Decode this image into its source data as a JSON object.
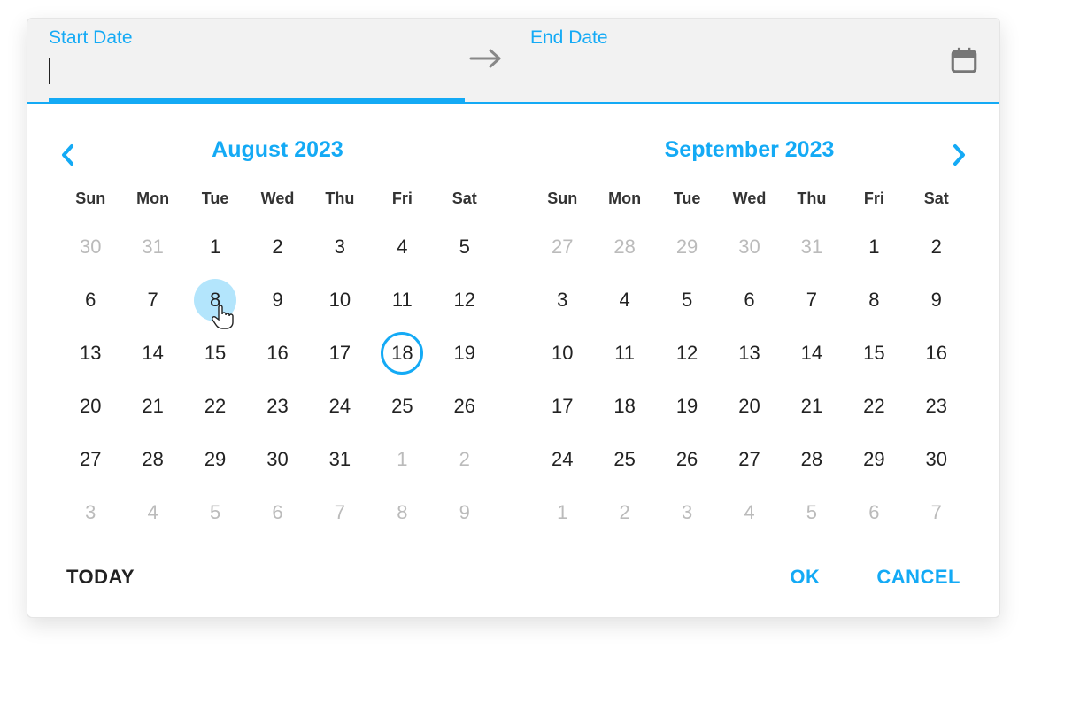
{
  "header": {
    "start_label": "Start Date",
    "end_label": "End Date"
  },
  "months": [
    {
      "title": "August 2023",
      "weekdays": [
        "Sun",
        "Mon",
        "Tue",
        "Wed",
        "Thu",
        "Fri",
        "Sat"
      ],
      "weeks": [
        [
          {
            "d": "30",
            "other": true
          },
          {
            "d": "31",
            "other": true
          },
          {
            "d": "1"
          },
          {
            "d": "2"
          },
          {
            "d": "3"
          },
          {
            "d": "4"
          },
          {
            "d": "5"
          }
        ],
        [
          {
            "d": "6"
          },
          {
            "d": "7"
          },
          {
            "d": "8",
            "hovered": true
          },
          {
            "d": "9"
          },
          {
            "d": "10"
          },
          {
            "d": "11"
          },
          {
            "d": "12"
          }
        ],
        [
          {
            "d": "13"
          },
          {
            "d": "14"
          },
          {
            "d": "15"
          },
          {
            "d": "16"
          },
          {
            "d": "17"
          },
          {
            "d": "18",
            "today": true
          },
          {
            "d": "19"
          }
        ],
        [
          {
            "d": "20"
          },
          {
            "d": "21"
          },
          {
            "d": "22"
          },
          {
            "d": "23"
          },
          {
            "d": "24"
          },
          {
            "d": "25"
          },
          {
            "d": "26"
          }
        ],
        [
          {
            "d": "27"
          },
          {
            "d": "28"
          },
          {
            "d": "29"
          },
          {
            "d": "30"
          },
          {
            "d": "31"
          },
          {
            "d": "1",
            "other": true
          },
          {
            "d": "2",
            "other": true
          }
        ],
        [
          {
            "d": "3",
            "other": true
          },
          {
            "d": "4",
            "other": true
          },
          {
            "d": "5",
            "other": true
          },
          {
            "d": "6",
            "other": true
          },
          {
            "d": "7",
            "other": true
          },
          {
            "d": "8",
            "other": true
          },
          {
            "d": "9",
            "other": true
          }
        ]
      ]
    },
    {
      "title": "September 2023",
      "weekdays": [
        "Sun",
        "Mon",
        "Tue",
        "Wed",
        "Thu",
        "Fri",
        "Sat"
      ],
      "weeks": [
        [
          {
            "d": "27",
            "other": true
          },
          {
            "d": "28",
            "other": true
          },
          {
            "d": "29",
            "other": true
          },
          {
            "d": "30",
            "other": true
          },
          {
            "d": "31",
            "other": true
          },
          {
            "d": "1"
          },
          {
            "d": "2"
          }
        ],
        [
          {
            "d": "3"
          },
          {
            "d": "4"
          },
          {
            "d": "5"
          },
          {
            "d": "6"
          },
          {
            "d": "7"
          },
          {
            "d": "8"
          },
          {
            "d": "9"
          }
        ],
        [
          {
            "d": "10"
          },
          {
            "d": "11"
          },
          {
            "d": "12"
          },
          {
            "d": "13"
          },
          {
            "d": "14"
          },
          {
            "d": "15"
          },
          {
            "d": "16"
          }
        ],
        [
          {
            "d": "17"
          },
          {
            "d": "18"
          },
          {
            "d": "19"
          },
          {
            "d": "20"
          },
          {
            "d": "21"
          },
          {
            "d": "22"
          },
          {
            "d": "23"
          }
        ],
        [
          {
            "d": "24"
          },
          {
            "d": "25"
          },
          {
            "d": "26"
          },
          {
            "d": "27"
          },
          {
            "d": "28"
          },
          {
            "d": "29"
          },
          {
            "d": "30"
          }
        ],
        [
          {
            "d": "1",
            "other": true
          },
          {
            "d": "2",
            "other": true
          },
          {
            "d": "3",
            "other": true
          },
          {
            "d": "4",
            "other": true
          },
          {
            "d": "5",
            "other": true
          },
          {
            "d": "6",
            "other": true
          },
          {
            "d": "7",
            "other": true
          }
        ]
      ]
    }
  ],
  "footer": {
    "today": "TODAY",
    "ok": "OK",
    "cancel": "CANCEL"
  },
  "colors": {
    "accent": "#14aaf5",
    "hover_fill": "#b3e5fc"
  },
  "icons": {
    "arrow_right": "arrow-right-icon",
    "calendar": "calendar-icon",
    "chevron_left": "chevron-left-icon",
    "chevron_right": "chevron-right-icon"
  }
}
